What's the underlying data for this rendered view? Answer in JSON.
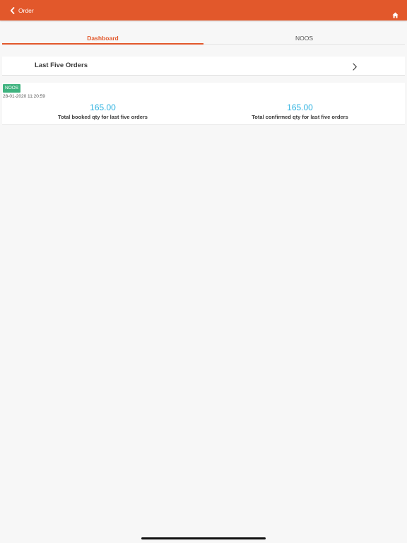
{
  "header": {
    "back_label": "Order",
    "accent_color": "#e2582b"
  },
  "tabs": [
    {
      "label": "Dashboard",
      "active": true
    },
    {
      "label": "NOOS",
      "active": false
    }
  ],
  "last_five": {
    "title": "Last Five Orders"
  },
  "order_summary": {
    "badge": "NOOS",
    "badge_color": "#3fb37f",
    "timestamp": "28-01-2020 11:20:59",
    "booked_value": "165.00",
    "booked_label": "Total booked qty for last five orders",
    "confirmed_value": "165.00",
    "confirmed_label": "Total confirmed qty for last five orders",
    "value_color": "#2fb2e0"
  },
  "icons": {
    "back": "chevron-left-icon",
    "home": "home-icon",
    "disclosure": "chevron-right-icon"
  }
}
